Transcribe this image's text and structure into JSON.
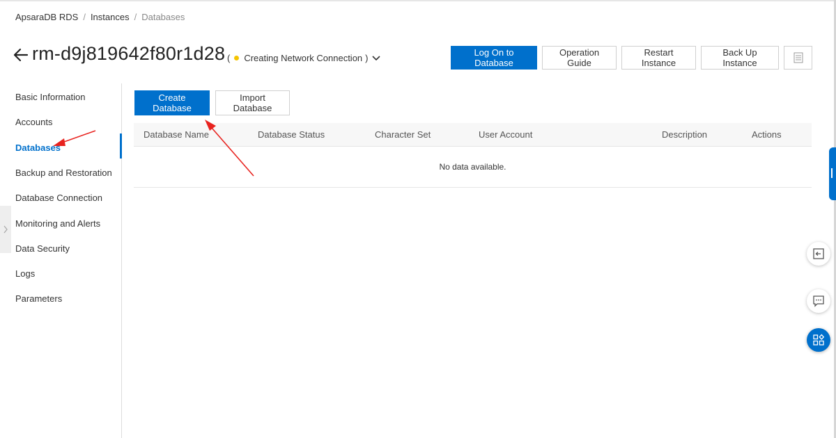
{
  "breadcrumb": {
    "items": [
      "ApsaraDB RDS",
      "Instances",
      "Databases"
    ],
    "separator": "/"
  },
  "header": {
    "back_icon": "arrow-left-icon",
    "instance_id": "rm-d9j819642f80r1d28",
    "status_open": "(",
    "status_text": "Creating Network Connection",
    "status_close": ")",
    "status_color": "#f5c400"
  },
  "toolbar": {
    "log_on_label": "Log On to Database",
    "operation_guide_label": "Operation Guide",
    "restart_label": "Restart Instance",
    "backup_label": "Back Up Instance",
    "more_icon": "list-icon"
  },
  "sidebar": {
    "items": [
      {
        "label": "Basic Information"
      },
      {
        "label": "Accounts"
      },
      {
        "label": "Databases"
      },
      {
        "label": "Backup and Restoration"
      },
      {
        "label": "Database Connection"
      },
      {
        "label": "Monitoring and Alerts"
      },
      {
        "label": "Data Security"
      },
      {
        "label": "Logs"
      },
      {
        "label": "Parameters"
      }
    ],
    "active": "Databases"
  },
  "main": {
    "create_label": "Create Database",
    "import_label": "Import Database",
    "table": {
      "columns": [
        "Database Name",
        "Database Status",
        "Character Set",
        "User Account",
        "Description",
        "Actions"
      ],
      "empty_text": "No data available."
    }
  },
  "colors": {
    "primary": "#0070cc",
    "annotation": "#e8231f"
  }
}
